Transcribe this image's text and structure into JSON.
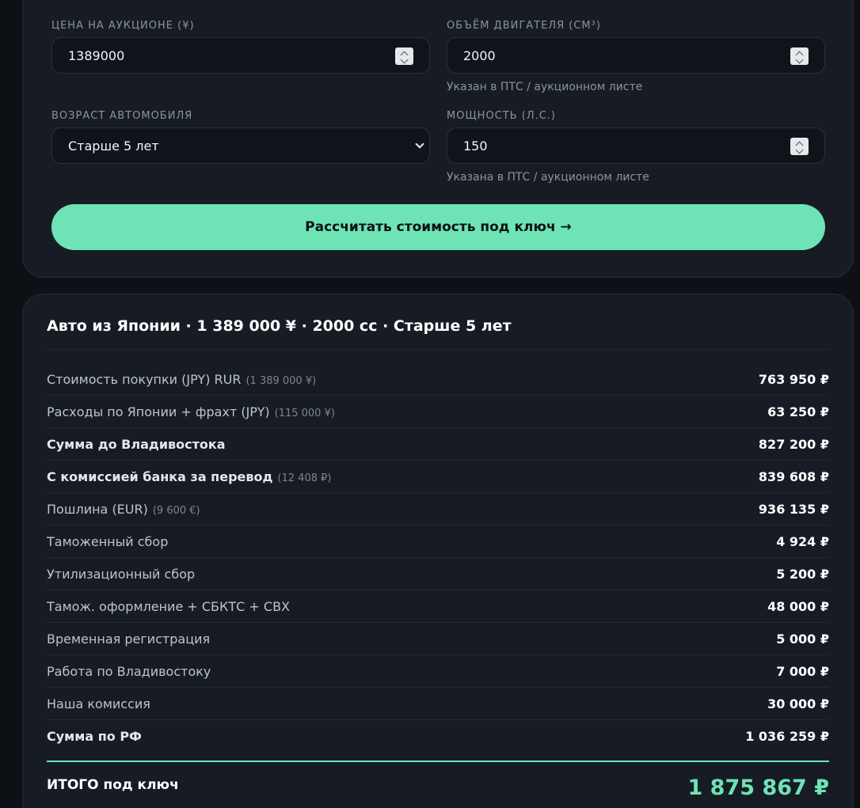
{
  "form": {
    "price": {
      "label": "ЦЕНА НА АУКЦИОНЕ (¥)",
      "value": "1389000"
    },
    "engine": {
      "label": "ОБЪЁМ ДВИГАТЕЛЯ (СМ³)",
      "value": "2000",
      "hint": "Указан в ПТС / аукционном листе"
    },
    "age": {
      "label": "ВОЗРАСТ АВТОМОБИЛЯ",
      "value": "Старше 5 лет"
    },
    "power": {
      "label": "МОЩНОСТЬ (Л.С.)",
      "value": "150",
      "hint": "Указана в ПТС / аукционном листе"
    },
    "calc_button": "Рассчитать стоимость под ключ →"
  },
  "result": {
    "title": "Авто из Японии · 1 389 000 ¥ · 2000 cc · Старше 5 лет",
    "rows": [
      {
        "label": "Стоимость покупки (JPY) RUR",
        "note": "(1 389 000 ¥)",
        "value": "763 950 ₽"
      },
      {
        "label": "Расходы по Японии + фрахт (JPY)",
        "note": "(115 000 ¥)",
        "value": "63 250 ₽"
      },
      {
        "label": "Сумма до Владивостока",
        "note": "",
        "value": "827 200 ₽"
      },
      {
        "label": "С комиссией банка за перевод",
        "note": "(12 408 ₽)",
        "value": "839 608 ₽"
      },
      {
        "label": "Пошлина (EUR)",
        "note": "(9 600 €)",
        "value": "936 135 ₽"
      },
      {
        "label": "Таможенный сбор",
        "note": "",
        "value": "4 924 ₽"
      },
      {
        "label": "Утилизационный сбор",
        "note": "",
        "value": "5 200 ₽"
      },
      {
        "label": "Тамож. оформление + СБКТС + СВХ",
        "note": "",
        "value": "48 000 ₽"
      },
      {
        "label": "Временная регистрация",
        "note": "",
        "value": "5 000 ₽"
      },
      {
        "label": "Работа по Владивостоку",
        "note": "",
        "value": "7 000 ₽"
      },
      {
        "label": "Наша комиссия",
        "note": "",
        "value": "30 000 ₽"
      },
      {
        "label": "Сумма по РФ",
        "note": "",
        "value": "1 036 259 ₽"
      }
    ],
    "total_label": "ИТОГО под ключ",
    "total_value": "1 875 867 ₽"
  },
  "colors": {
    "accent": "#6ee3b6",
    "panel": "#171c24",
    "background": "#0d1014"
  }
}
